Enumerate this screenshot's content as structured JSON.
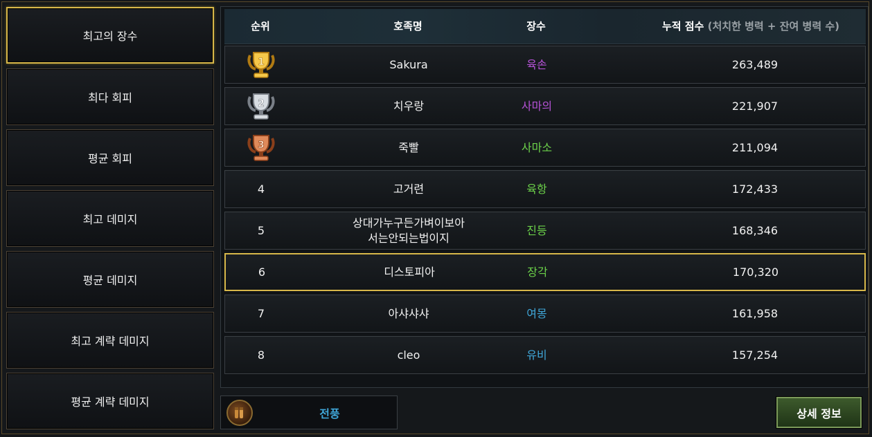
{
  "sidebar": {
    "items": [
      {
        "label": "최고의 장수",
        "active": true
      },
      {
        "label": "최다 회피",
        "active": false
      },
      {
        "label": "평균 회피",
        "active": false
      },
      {
        "label": "최고 데미지",
        "active": false
      },
      {
        "label": "평균 데미지",
        "active": false
      },
      {
        "label": "최고 계략 데미지",
        "active": false
      },
      {
        "label": "평균 계략 데미지",
        "active": false
      }
    ]
  },
  "table": {
    "headers": {
      "rank": "순위",
      "clan": "호족명",
      "general": "장수",
      "score": "누적 점수",
      "score_sub": "(처치한 병력 + 잔여 병력 수)"
    },
    "rows": [
      {
        "rank": "1",
        "medal": "gold",
        "clan": "Sakura",
        "clan2": "",
        "general": "육손",
        "general_color": "#b552d6",
        "score": "263,489"
      },
      {
        "rank": "2",
        "medal": "silver",
        "clan": "치우랑",
        "clan2": "",
        "general": "사마의",
        "general_color": "#b552d6",
        "score": "221,907"
      },
      {
        "rank": "3",
        "medal": "bronze",
        "clan": "죽빨",
        "clan2": "",
        "general": "사마소",
        "general_color": "#6cd24a",
        "score": "211,094"
      },
      {
        "rank": "4",
        "medal": "",
        "clan": "고거련",
        "clan2": "",
        "general": "육항",
        "general_color": "#6cd24a",
        "score": "172,433"
      },
      {
        "rank": "5",
        "medal": "",
        "clan": "상대가누구든가벼이보아",
        "clan2": "서는안되는법이지",
        "general": "진등",
        "general_color": "#6cd24a",
        "score": "168,346"
      },
      {
        "rank": "6",
        "medal": "",
        "clan": "디스토피아",
        "clan2": "",
        "general": "장각",
        "general_color": "#6cd24a",
        "score": "170,320"
      },
      {
        "rank": "7",
        "medal": "",
        "clan": "아샤샤샤",
        "clan2": "",
        "general": "여몽",
        "general_color": "#3fa6d8",
        "score": "161,958"
      },
      {
        "rank": "8",
        "medal": "",
        "clan": "cleo",
        "clan2": "",
        "general": "유비",
        "general_color": "#3fa6d8",
        "score": "157,254"
      }
    ]
  },
  "skill": {
    "label": "전풍",
    "icon": "bullets-icon"
  },
  "detail_button": "상세 정보",
  "colors": {
    "accent_gold": "#d8b84a",
    "green_button": "#3d5a2c"
  }
}
